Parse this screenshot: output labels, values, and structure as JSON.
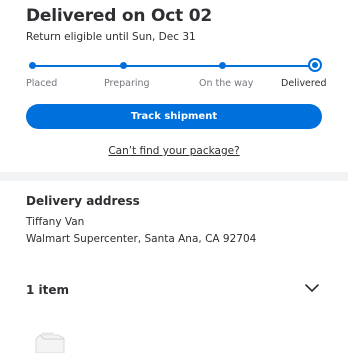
{
  "header": {
    "title": "Delivered on Oct 02",
    "subtitle": "Return eligible until Sun, Dec 31"
  },
  "progress": {
    "steps": [
      "Placed",
      "Preparing",
      "On the way",
      "Delivered"
    ],
    "current_step": 4
  },
  "actions": {
    "track_label": "Track shipment",
    "cant_find_label": "Can’t find your package?"
  },
  "delivery": {
    "title": "Delivery address",
    "name": "Tiffany Van",
    "address": "Walmart Supercenter, Santa Ana, CA 92704"
  },
  "items": {
    "count_label": "1 item"
  },
  "icons": {
    "expand": "chevron-down-icon",
    "product": "product-thumbnail"
  },
  "colors": {
    "accent": "#0071dc",
    "text": "#2e2f32",
    "muted": "#74767c",
    "divider": "#f2f3f5"
  }
}
